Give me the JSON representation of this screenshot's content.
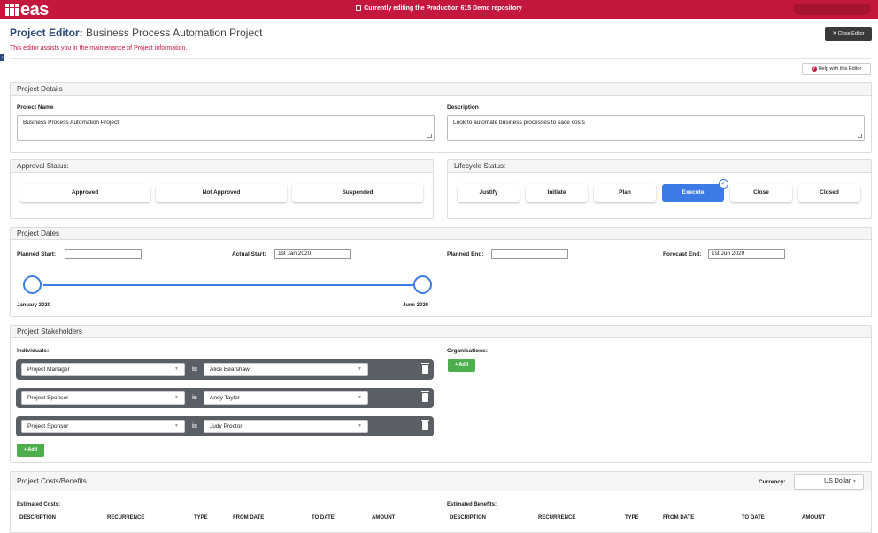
{
  "app": {
    "logo": "eas",
    "banner": "Currently editing the Production 615 Demo repository"
  },
  "header": {
    "title_prefix": "Project Editor:",
    "title_name": "Business Process Automation Project",
    "subtitle": "This editor assists you in the maintenance of Project information.",
    "close_label": "✕ Close Editor",
    "help_label": "Help with this Editor",
    "side_tab": "›"
  },
  "details": {
    "heading": "Project Details",
    "name_label": "Project Name",
    "name_value": "Business Process Automation Project",
    "desc_label": "Description",
    "desc_value": "Look to automate business processes to sace costs"
  },
  "approval": {
    "heading": "Approval Status:",
    "options": [
      "Approved",
      "Not Approved",
      "Suspended"
    ]
  },
  "lifecycle": {
    "heading": "Lifecycle Status:",
    "options": [
      "Justify",
      "Initiate",
      "Plan",
      "Execute",
      "Close",
      "Closed"
    ],
    "selected": "Execute"
  },
  "dates": {
    "heading": "Project Dates",
    "planned_start_label": "Planned Start:",
    "planned_start": "",
    "actual_start_label": "Actual Start:",
    "actual_start": "1st Jan 2020",
    "planned_end_label": "Planned End:",
    "planned_end": "",
    "forecast_end_label": "Forecast End:",
    "forecast_end": "1st Jun 2020",
    "timeline_start": "January 2020",
    "timeline_end": "June 2020"
  },
  "stakeholders": {
    "heading": "Project Stakeholders",
    "individuals_label": "Individuals:",
    "organisations_label": "Organisations:",
    "is_label": "is",
    "rows": [
      {
        "role": "Project Manager",
        "person": "Alice Bearshaw"
      },
      {
        "role": "Project Sponsor",
        "person": "Andy Taylor"
      },
      {
        "role": "Project Sponsor",
        "person": "Judy Proctor"
      }
    ],
    "add_label": "+ Add"
  },
  "costs": {
    "heading": "Project Costs/Benefits",
    "currency_label": "Currency:",
    "currency_value": "US Dollar",
    "est_costs_label": "Estimated Costs:",
    "est_benefits_label": "Estimated Benefits:",
    "columns": [
      "DESCRIPTION",
      "RECURRENCE",
      "TYPE",
      "FROM DATE",
      "TO DATE",
      "AMOUNT"
    ]
  },
  "colors": {
    "brand": "#c3173d",
    "accent": "#3c7be5",
    "add": "#4cae4c"
  }
}
